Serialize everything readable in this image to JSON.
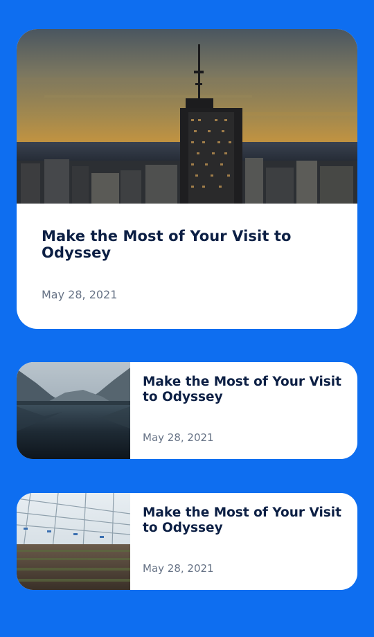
{
  "cards": [
    {
      "title": "Make the Most of Your Visit to Odyssey",
      "date": "May 28, 2021",
      "image": "city-skyline-at-dusk"
    },
    {
      "title": "Make the Most of Your Visit to Odyssey",
      "date": "May 28, 2021",
      "image": "mountain-lake"
    },
    {
      "title": "Make the Most of Your Visit to Odyssey",
      "date": "May 28, 2021",
      "image": "greenhouse-interior"
    }
  ],
  "colors": {
    "background": "#0e6ef0",
    "card": "#ffffff",
    "title": "#0c1f44",
    "date": "#677386"
  }
}
